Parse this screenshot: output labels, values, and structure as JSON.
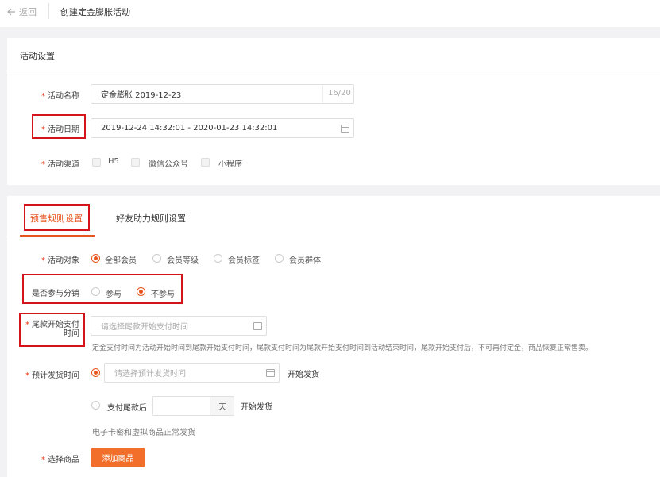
{
  "header": {
    "back_label": "返回",
    "back_icon": "arrow-left-icon",
    "title": "创建定金膨胀活动"
  },
  "activity_settings": {
    "title": "活动设置",
    "name": {
      "label": "活动名称",
      "value": "定金膨胀  2019-12-23",
      "counter": "16/20"
    },
    "date": {
      "label": "活动日期",
      "value": "2019-12-24 14:32:01 - 2020-01-23 14:32:01"
    },
    "channel": {
      "label": "活动渠道",
      "options": [
        "H5",
        "微信公众号",
        "小程序"
      ]
    }
  },
  "tabs": [
    {
      "label": "预售规则设置",
      "active": true
    },
    {
      "label": "好友助力规则设置",
      "active": false
    }
  ],
  "rules": {
    "target": {
      "label": "活动对象",
      "options": [
        "全部会员",
        "会员等级",
        "会员标签",
        "会员群体"
      ],
      "selected": "全部会员"
    },
    "distribution": {
      "label": "是否参与分销",
      "options": [
        "参与",
        "不参与"
      ],
      "selected": "不参与"
    },
    "balance_start": {
      "label_line1": "尾款开始支付",
      "label_line2": "时间",
      "placeholder": "请选择尾款开始支付时间",
      "hint": "定金支付时间为活动开始时间到尾款开始支付时间，尾款支付时间为尾款开始支付时间到活动结束时间，尾款开始支付后，不可再付定金，商品恢复正常售卖。"
    },
    "shipping": {
      "label": "预计发货时间",
      "placeholder": "请选择预计发货时间",
      "suffix": "开始发货",
      "option2_prefix": "支付尾款后",
      "days_unit": "天",
      "option2_suffix": "开始发货",
      "note": "电子卡密和虚拟商品正常发货"
    },
    "products": {
      "label": "选择商品",
      "button": "添加商品"
    }
  },
  "colors": {
    "accent": "#e8541d",
    "required": "#e8380d",
    "highlight_box": "#d4131b",
    "button": "#f26f2b"
  }
}
